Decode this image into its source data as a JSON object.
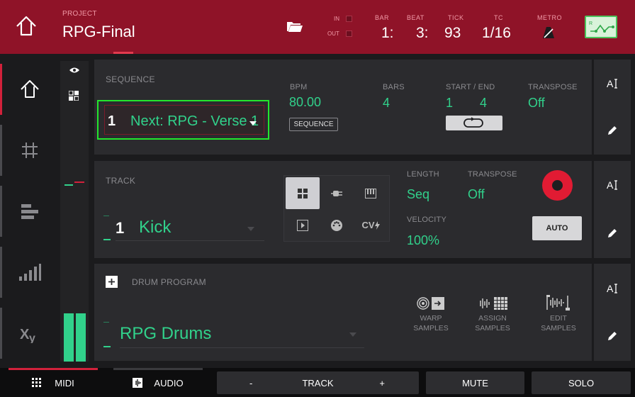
{
  "header": {
    "project_label": "PROJECT",
    "project_name": "RPG-Final",
    "in_label": "IN",
    "out_label": "OUT",
    "bar_label": "BAR",
    "bar_value": "1:",
    "beat_label": "BEAT",
    "beat_value": "3:",
    "tick_label": "TICK",
    "tick_value": "93",
    "tc_label": "TC",
    "tc_value": "1/16",
    "metro_label": "METRO"
  },
  "left_nav": [
    "home",
    "grid",
    "list",
    "levels",
    "xy"
  ],
  "sequence": {
    "label": "SEQUENCE",
    "number": "1",
    "name": "Next: RPG - Verse 1",
    "bpm_label": "BPM",
    "bpm_value": "80.00",
    "bpm_button": "SEQUENCE",
    "bars_label": "BARS",
    "bars_value": "4",
    "start_end_label": "START  /  END",
    "start_value": "1",
    "end_value": "4",
    "transpose_label": "TRANSPOSE",
    "transpose_value": "Off"
  },
  "track": {
    "label": "TRACK",
    "number": "1",
    "name": "Kick",
    "length_label": "LENGTH",
    "length_value": "Seq",
    "transpose_label": "TRANSPOSE",
    "transpose_value": "Off",
    "velocity_label": "VELOCITY",
    "velocity_value": "100%",
    "cv_label": "CV",
    "auto_label": "AUTO"
  },
  "program": {
    "label": "DRUM PROGRAM",
    "name": "RPG Drums",
    "warp_line1": "WARP",
    "warp_line2": "SAMPLES",
    "assign_line1": "ASSIGN",
    "assign_line2": "SAMPLES",
    "edit_line1": "EDIT",
    "edit_line2": "SAMPLES"
  },
  "bottom": {
    "midi": "MIDI",
    "audio": "AUDIO",
    "minus": "-",
    "track": "TRACK",
    "plus": "+",
    "mute": "MUTE",
    "solo": "SOLO"
  },
  "colors": {
    "header_red": "#8f1328",
    "accent_green": "#31d18b",
    "focus_green": "#23e62d",
    "record_red": "#e11b33"
  }
}
